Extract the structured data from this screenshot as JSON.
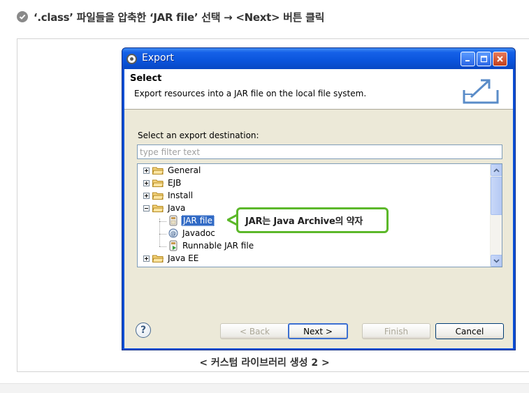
{
  "instruction": {
    "text": "‘.class’ 파일들을 압축한 ‘JAR file’ 선택 → <Next> 버튼 클릭"
  },
  "dialog": {
    "title": "Export",
    "window_buttons": [
      "minimize-icon",
      "maximize-icon",
      "close-icon"
    ],
    "header": {
      "title": "Select",
      "description": "Export resources into a JAR file on the local file system."
    },
    "destination_label": "Select an export destination:",
    "filter_placeholder": "type filter text",
    "tree": [
      {
        "label": "General",
        "expanded": false,
        "level": 0
      },
      {
        "label": "EJB",
        "expanded": false,
        "level": 0
      },
      {
        "label": "Install",
        "expanded": false,
        "level": 0
      },
      {
        "label": "Java",
        "expanded": true,
        "level": 0
      },
      {
        "label": "JAR file",
        "level": 1,
        "selected": true
      },
      {
        "label": "Javadoc",
        "level": 1
      },
      {
        "label": "Runnable JAR file",
        "level": 1
      },
      {
        "label": "Java EE",
        "expanded": false,
        "level": 0
      }
    ],
    "buttons": {
      "help": "?",
      "back": "< Back",
      "next": "Next >",
      "finish": "Finish",
      "cancel": "Cancel"
    }
  },
  "callout": {
    "text": "JAR는 Java Archive의 약자",
    "color": "#5cb82a"
  },
  "caption": "< 커스텀 라이브러리 생성 2 >",
  "colors": {
    "titlebar": "#0a54dc",
    "dialog_bg": "#ece9d8",
    "selection": "#316ac5"
  }
}
